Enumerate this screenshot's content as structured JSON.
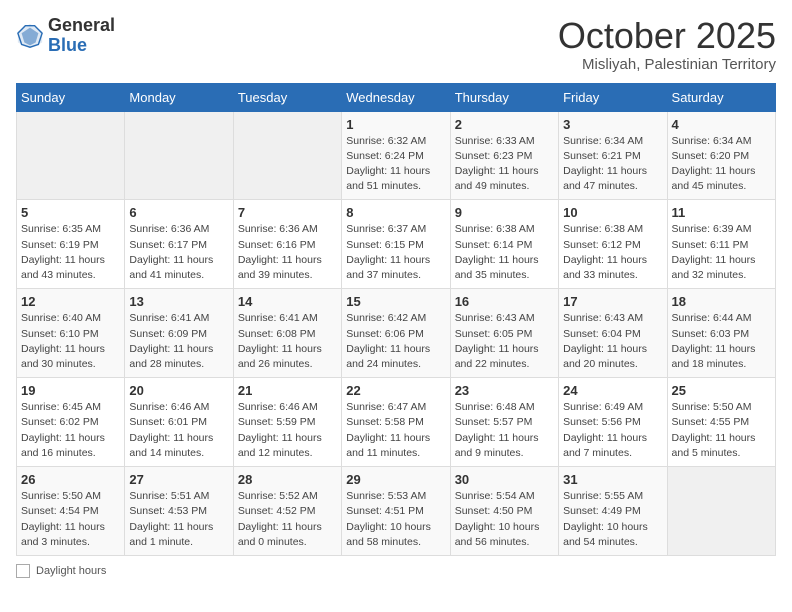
{
  "header": {
    "logo_general": "General",
    "logo_blue": "Blue",
    "month_title": "October 2025",
    "subtitle": "Misliyah, Palestinian Territory"
  },
  "days_of_week": [
    "Sunday",
    "Monday",
    "Tuesday",
    "Wednesday",
    "Thursday",
    "Friday",
    "Saturday"
  ],
  "legend_label": "Daylight hours",
  "weeks": [
    [
      {
        "day": "",
        "info": ""
      },
      {
        "day": "",
        "info": ""
      },
      {
        "day": "",
        "info": ""
      },
      {
        "day": "1",
        "info": "Sunrise: 6:32 AM\nSunset: 6:24 PM\nDaylight: 11 hours\nand 51 minutes."
      },
      {
        "day": "2",
        "info": "Sunrise: 6:33 AM\nSunset: 6:23 PM\nDaylight: 11 hours\nand 49 minutes."
      },
      {
        "day": "3",
        "info": "Sunrise: 6:34 AM\nSunset: 6:21 PM\nDaylight: 11 hours\nand 47 minutes."
      },
      {
        "day": "4",
        "info": "Sunrise: 6:34 AM\nSunset: 6:20 PM\nDaylight: 11 hours\nand 45 minutes."
      }
    ],
    [
      {
        "day": "5",
        "info": "Sunrise: 6:35 AM\nSunset: 6:19 PM\nDaylight: 11 hours\nand 43 minutes."
      },
      {
        "day": "6",
        "info": "Sunrise: 6:36 AM\nSunset: 6:17 PM\nDaylight: 11 hours\nand 41 minutes."
      },
      {
        "day": "7",
        "info": "Sunrise: 6:36 AM\nSunset: 6:16 PM\nDaylight: 11 hours\nand 39 minutes."
      },
      {
        "day": "8",
        "info": "Sunrise: 6:37 AM\nSunset: 6:15 PM\nDaylight: 11 hours\nand 37 minutes."
      },
      {
        "day": "9",
        "info": "Sunrise: 6:38 AM\nSunset: 6:14 PM\nDaylight: 11 hours\nand 35 minutes."
      },
      {
        "day": "10",
        "info": "Sunrise: 6:38 AM\nSunset: 6:12 PM\nDaylight: 11 hours\nand 33 minutes."
      },
      {
        "day": "11",
        "info": "Sunrise: 6:39 AM\nSunset: 6:11 PM\nDaylight: 11 hours\nand 32 minutes."
      }
    ],
    [
      {
        "day": "12",
        "info": "Sunrise: 6:40 AM\nSunset: 6:10 PM\nDaylight: 11 hours\nand 30 minutes."
      },
      {
        "day": "13",
        "info": "Sunrise: 6:41 AM\nSunset: 6:09 PM\nDaylight: 11 hours\nand 28 minutes."
      },
      {
        "day": "14",
        "info": "Sunrise: 6:41 AM\nSunset: 6:08 PM\nDaylight: 11 hours\nand 26 minutes."
      },
      {
        "day": "15",
        "info": "Sunrise: 6:42 AM\nSunset: 6:06 PM\nDaylight: 11 hours\nand 24 minutes."
      },
      {
        "day": "16",
        "info": "Sunrise: 6:43 AM\nSunset: 6:05 PM\nDaylight: 11 hours\nand 22 minutes."
      },
      {
        "day": "17",
        "info": "Sunrise: 6:43 AM\nSunset: 6:04 PM\nDaylight: 11 hours\nand 20 minutes."
      },
      {
        "day": "18",
        "info": "Sunrise: 6:44 AM\nSunset: 6:03 PM\nDaylight: 11 hours\nand 18 minutes."
      }
    ],
    [
      {
        "day": "19",
        "info": "Sunrise: 6:45 AM\nSunset: 6:02 PM\nDaylight: 11 hours\nand 16 minutes."
      },
      {
        "day": "20",
        "info": "Sunrise: 6:46 AM\nSunset: 6:01 PM\nDaylight: 11 hours\nand 14 minutes."
      },
      {
        "day": "21",
        "info": "Sunrise: 6:46 AM\nSunset: 5:59 PM\nDaylight: 11 hours\nand 12 minutes."
      },
      {
        "day": "22",
        "info": "Sunrise: 6:47 AM\nSunset: 5:58 PM\nDaylight: 11 hours\nand 11 minutes."
      },
      {
        "day": "23",
        "info": "Sunrise: 6:48 AM\nSunset: 5:57 PM\nDaylight: 11 hours\nand 9 minutes."
      },
      {
        "day": "24",
        "info": "Sunrise: 6:49 AM\nSunset: 5:56 PM\nDaylight: 11 hours\nand 7 minutes."
      },
      {
        "day": "25",
        "info": "Sunrise: 5:50 AM\nSunset: 4:55 PM\nDaylight: 11 hours\nand 5 minutes."
      }
    ],
    [
      {
        "day": "26",
        "info": "Sunrise: 5:50 AM\nSunset: 4:54 PM\nDaylight: 11 hours\nand 3 minutes."
      },
      {
        "day": "27",
        "info": "Sunrise: 5:51 AM\nSunset: 4:53 PM\nDaylight: 11 hours\nand 1 minute."
      },
      {
        "day": "28",
        "info": "Sunrise: 5:52 AM\nSunset: 4:52 PM\nDaylight: 11 hours\nand 0 minutes."
      },
      {
        "day": "29",
        "info": "Sunrise: 5:53 AM\nSunset: 4:51 PM\nDaylight: 10 hours\nand 58 minutes."
      },
      {
        "day": "30",
        "info": "Sunrise: 5:54 AM\nSunset: 4:50 PM\nDaylight: 10 hours\nand 56 minutes."
      },
      {
        "day": "31",
        "info": "Sunrise: 5:55 AM\nSunset: 4:49 PM\nDaylight: 10 hours\nand 54 minutes."
      },
      {
        "day": "",
        "info": ""
      }
    ]
  ]
}
